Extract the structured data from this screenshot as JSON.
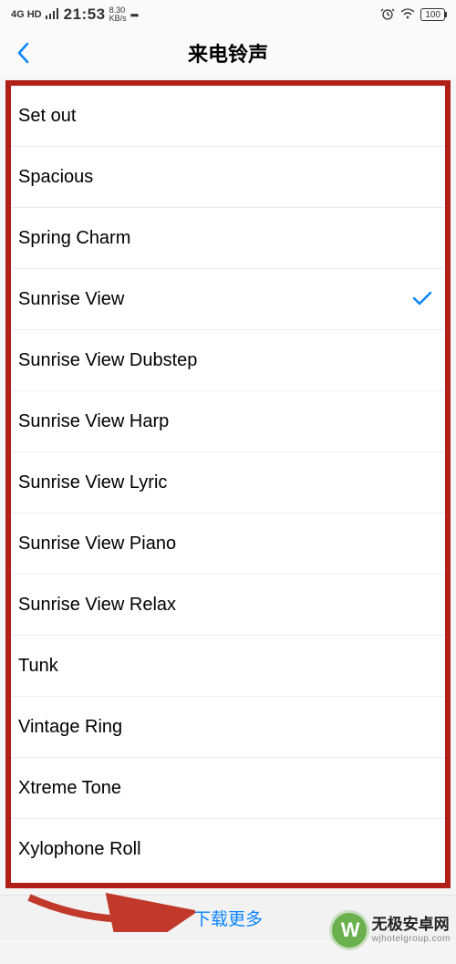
{
  "statusBar": {
    "network": "4G HD",
    "time": "21:53",
    "speed": "8.30",
    "speedUnit": "KB/s",
    "dots": "•••",
    "alarm": "⏰",
    "wifi": "≈",
    "battery": "100"
  },
  "header": {
    "title": "来电铃声"
  },
  "ringtones": [
    {
      "label": "Set out",
      "selected": false
    },
    {
      "label": "Spacious",
      "selected": false
    },
    {
      "label": "Spring Charm",
      "selected": false
    },
    {
      "label": "Sunrise View",
      "selected": true
    },
    {
      "label": "Sunrise View Dubstep",
      "selected": false
    },
    {
      "label": "Sunrise View Harp",
      "selected": false
    },
    {
      "label": "Sunrise View Lyric",
      "selected": false
    },
    {
      "label": "Sunrise View Piano",
      "selected": false
    },
    {
      "label": "Sunrise View Relax",
      "selected": false
    },
    {
      "label": "Tunk",
      "selected": false
    },
    {
      "label": "Vintage Ring",
      "selected": false
    },
    {
      "label": "Xtreme Tone",
      "selected": false
    },
    {
      "label": "Xylophone Roll",
      "selected": false
    }
  ],
  "footer": {
    "downloadMore": "下载更多"
  },
  "watermark": {
    "logo": "W",
    "main": "无极安卓网",
    "sub": "wjhotelgroup.com"
  }
}
